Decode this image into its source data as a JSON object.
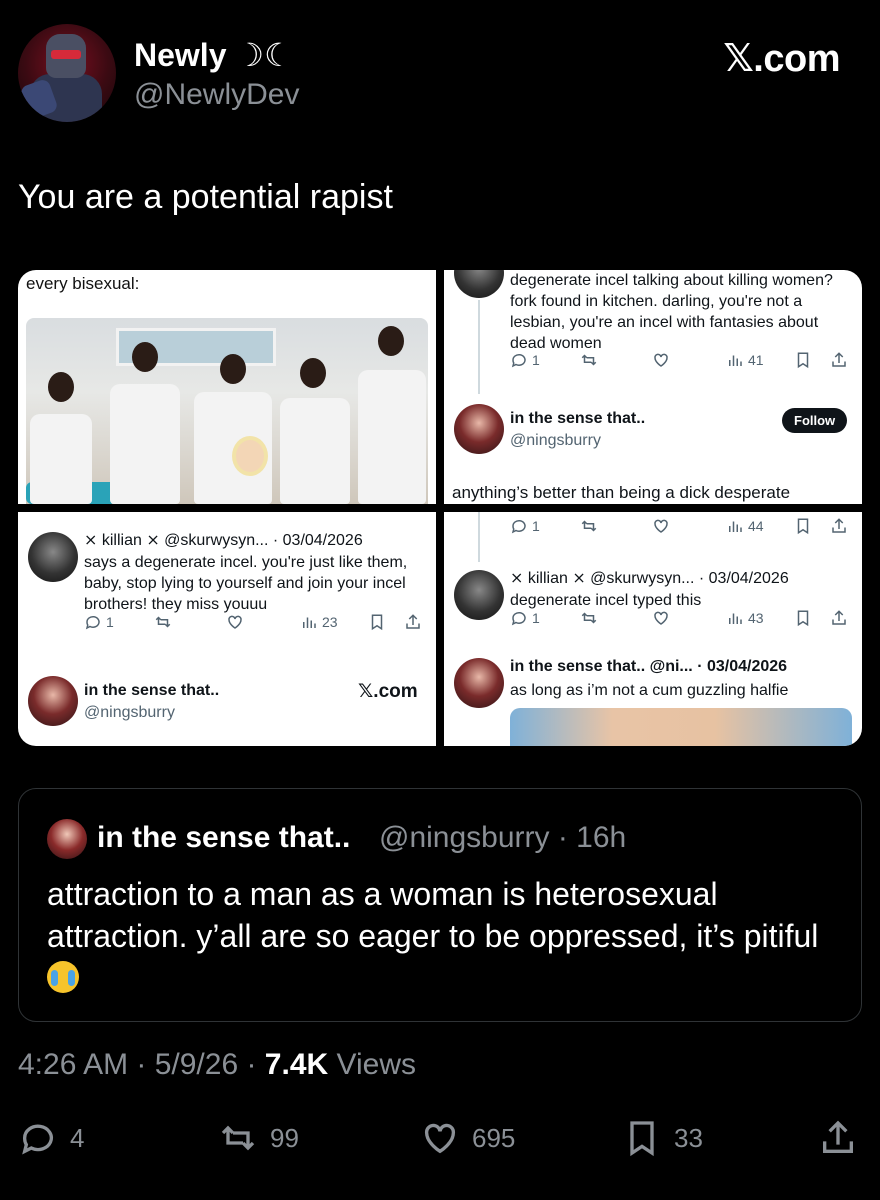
{
  "author": {
    "name": "Newly ☽☾",
    "handle": "@NewlyDev"
  },
  "brand": {
    "logo_text": "𝕏.com"
  },
  "tweet": {
    "text": "You are a potential rapist"
  },
  "panels": {
    "p1": {
      "caption": "every bisexual:"
    },
    "p2": {
      "tweet_text": "degenerate incel talking about killing women? fork found in kitchen. darling, you're not a lesbian, you're an incel with fantasies about dead women",
      "reply": "1",
      "views": "41",
      "user_name": "in the sense that..",
      "user_handle": "@ningsburry",
      "follow_label": "Follow",
      "reply_text": "anything’s better than being a dick desperate"
    },
    "p3": {
      "meta": "⨯ killian ⨯ @skurwysyn... · 03/04/2026",
      "text": "says a degenerate incel. you're just like them, baby, stop lying to yourself and join your incel brothers! they miss youuu",
      "reply": "1",
      "views": "23",
      "user_name": "in the sense that..",
      "user_handle": "@ningsburry",
      "logo_text": "𝕏.com"
    },
    "p4": {
      "reply1": "1",
      "views1": "44",
      "meta": "⨯ killian ⨯ @skurwysyn... · 03/04/2026",
      "text": "degenerate incel typed this",
      "reply2": "1",
      "views2": "43",
      "meta2": "in the sense that.. @ni... · 03/04/2026",
      "text2": "as long as i’m not a cum guzzling halfie"
    }
  },
  "quote": {
    "name": "in the sense that..",
    "handle": "@ningsburry · 16h",
    "text": "attraction to a man as a woman is heterosexual attraction. y’all are so eager to be oppressed, it’s pitiful"
  },
  "meta": {
    "time": "4:26 AM · 5/9/26 · ",
    "views_count": "7.4K",
    "views_label": " Views"
  },
  "stats": {
    "replies": "4",
    "reposts": "99",
    "likes": "695",
    "bookmarks": "33"
  },
  "icons": [
    "reply-icon",
    "repost-icon",
    "like-icon",
    "views-icon",
    "bookmark-icon",
    "share-icon"
  ]
}
